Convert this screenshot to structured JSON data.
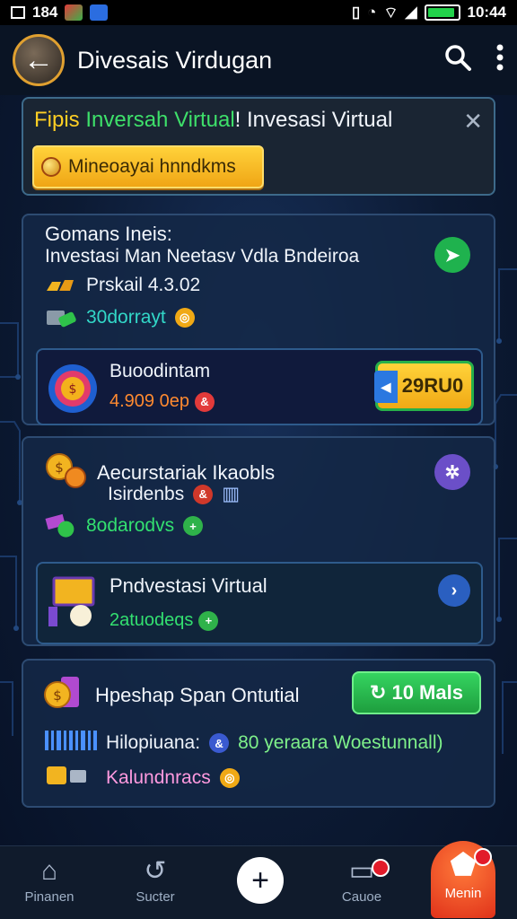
{
  "status": {
    "time_left": "184",
    "time_right": "10:44"
  },
  "appbar": {
    "title": "Divesais Virdugan"
  },
  "banner": {
    "title_part1": "Fipis ",
    "title_part2": "Inversah Virtual",
    "title_part3": "! Invesasi Virtual",
    "button_label": "Mineoayai hnndkms"
  },
  "card1": {
    "title": "Gomans Ineis:",
    "subtitle": "Investasi Man Neetasv Vdla Bndeiroa",
    "row1": "Prskail 4.3.02",
    "row2": "30dorrayt",
    "inner_title": "Buoodintam",
    "inner_value": "4.909 0ep",
    "inner_button": "29RU0"
  },
  "card2": {
    "title": "Aecurstariak Ikaobls",
    "row1": "Isirdenbs",
    "row2": "8odarodvs",
    "inner_title": "Pndvestasi Virtual",
    "inner_value": "2atuodeqs"
  },
  "card3": {
    "title": "Hpeshap Span Ontutial",
    "button_label": "10 Mals",
    "row1_label": "Hilopiuana:",
    "row1_value": "80 yeraara Woestunnall)",
    "row2": "Kalundnracs"
  },
  "bottomnav": {
    "items": [
      {
        "label": "Pinanen",
        "icon": "home-icon"
      },
      {
        "label": "Sucter",
        "icon": "refresh-icon"
      },
      {
        "label": "Cauoe",
        "icon": "wallet-icon"
      },
      {
        "label": "Menin",
        "icon": "menu-icon"
      }
    ]
  },
  "colors": {
    "accent_yellow": "#ffcf24",
    "accent_green": "#33e070",
    "card_border": "#2d4b72",
    "menu_red": "#e0321a"
  }
}
